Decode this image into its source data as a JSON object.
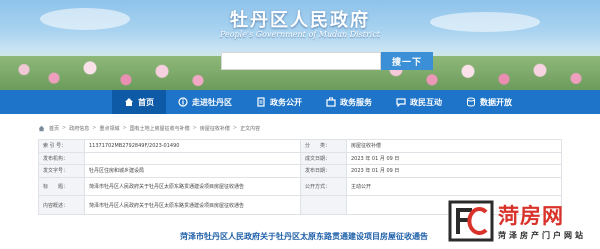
{
  "header": {
    "title": "牡丹区人民政府",
    "subtitle": "People's Government of Mudan District",
    "search": {
      "placeholder": "",
      "button_label": "搜一下"
    }
  },
  "nav": {
    "items": [
      {
        "label": "首页",
        "icon": "home-icon",
        "active": true
      },
      {
        "label": "走进牡丹区",
        "icon": "info-icon",
        "active": false
      },
      {
        "label": "政务公开",
        "icon": "document-icon",
        "active": false
      },
      {
        "label": "政务服务",
        "icon": "service-icon",
        "active": false
      },
      {
        "label": "政民互动",
        "icon": "chat-icon",
        "active": false
      },
      {
        "label": "数据开放",
        "icon": "data-icon",
        "active": false
      }
    ]
  },
  "breadcrumb": [
    "首页",
    "政府信息",
    "重点领域",
    "国有土地上房屋征收与补偿",
    "房屋征收补偿",
    "正文内容"
  ],
  "info": {
    "rows": [
      {
        "l1": "索 引 号：",
        "v1": "11371702MB2792849F/2023-01490",
        "l2": "分　　类：",
        "v2": "房屋征收补偿"
      },
      {
        "l1": "发布机构：",
        "v1": "",
        "l2": "成文日期：",
        "v2": "2023 年 01 月 09 日"
      },
      {
        "l1": "发文字号：",
        "v1": "牡丹区住房和城乡建设局",
        "l2": "发布日期：",
        "v2": "2023 年 01 月 09 日"
      },
      {
        "l1": "标　　题：",
        "v1": "菏泽市牡丹区人民政府关于牡丹区太原东路贯通建设项目房屋征收通告",
        "l2": "公开方式：",
        "v2": "主动公开"
      },
      {
        "l1": "内容概述：",
        "v1": "菏泽市牡丹区人民政府关于牡丹区太原东路贯通建设项目房屋征收通告",
        "l2": "",
        "v2": ""
      }
    ]
  },
  "article": {
    "title": "菏泽市牡丹区人民政府关于牡丹区太原东路贯通建设项目房屋征收通告"
  },
  "watermark": {
    "name": "菏房网",
    "sub": "菏泽房产门户网站"
  },
  "colors": {
    "nav_bg": "#1d74c8",
    "nav_active": "#0f5aa6",
    "title_blue": "#1d5fa8",
    "watermark_red": "#d8322a"
  }
}
